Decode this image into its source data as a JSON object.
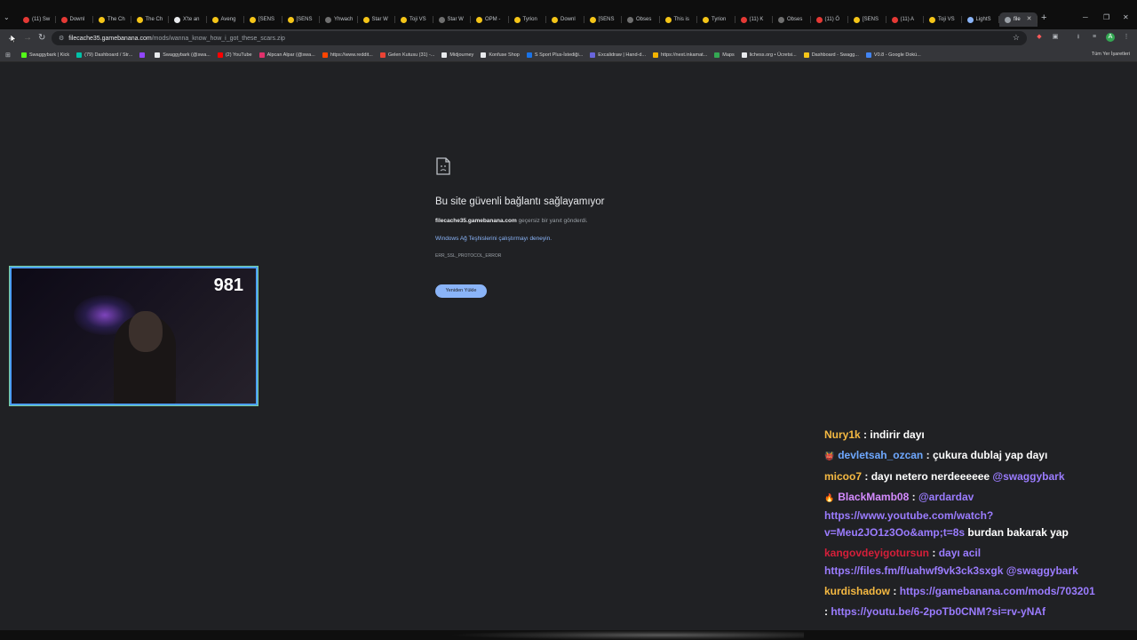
{
  "tabs": [
    {
      "label": "(11) Sw",
      "color": "#e53935"
    },
    {
      "label": "Downl",
      "color": "#e53935"
    },
    {
      "label": "The Ch",
      "color": "#f5c518"
    },
    {
      "label": "The Ch",
      "color": "#f5c518"
    },
    {
      "label": "X'te an",
      "color": "#e8eaed"
    },
    {
      "label": "Aveng",
      "color": "#f5c518"
    },
    {
      "label": "[SENS",
      "color": "#f5c518"
    },
    {
      "label": "[SENS",
      "color": "#f5c518"
    },
    {
      "label": "Yhwach",
      "color": "#6f6f6f"
    },
    {
      "label": "Star W",
      "color": "#f5c518"
    },
    {
      "label": "Toji VS",
      "color": "#f5c518"
    },
    {
      "label": "Star W",
      "color": "#6f6f6f"
    },
    {
      "label": "OPM -",
      "color": "#f5c518"
    },
    {
      "label": "Tyrion",
      "color": "#f5c518"
    },
    {
      "label": "Downl",
      "color": "#f5c518"
    },
    {
      "label": "[SENS",
      "color": "#f5c518"
    },
    {
      "label": "Obses",
      "color": "#6f6f6f"
    },
    {
      "label": "This is",
      "color": "#f5c518"
    },
    {
      "label": "Tyrion",
      "color": "#f5c518"
    },
    {
      "label": "(11) K",
      "color": "#e53935"
    },
    {
      "label": "Obses",
      "color": "#6f6f6f"
    },
    {
      "label": "(11) Ö",
      "color": "#e53935"
    },
    {
      "label": "[SENS",
      "color": "#f5c518"
    },
    {
      "label": "(11) A",
      "color": "#e53935"
    },
    {
      "label": "Toji VS",
      "color": "#f5c518"
    },
    {
      "label": "LightS",
      "color": "#8ab4f8"
    },
    {
      "label": "file",
      "color": "#9aa0a6",
      "active": true
    }
  ],
  "address": {
    "host": "filecache35.gamebanana.com",
    "path": "/mods/wanna_know_how_i_got_these_scars.zip"
  },
  "bookmarks": [
    {
      "label": "Swaggybark | Kick",
      "color": "#53fc18"
    },
    {
      "label": "(79) Dashboard / Str...",
      "color": "#00c2a8"
    },
    {
      "label": "",
      "color": "#9146ff"
    },
    {
      "label": "Swaggybark (@swa...",
      "color": "#e8eaed"
    },
    {
      "label": "(2) YouTube",
      "color": "#ff0000"
    },
    {
      "label": "Alpcan Alpar (@swa...",
      "color": "#e1306c"
    },
    {
      "label": "https://www.reddit...",
      "color": "#ff4500"
    },
    {
      "label": "Gelen Kutusu (31) -...",
      "color": "#ea4335"
    },
    {
      "label": "Midjourney",
      "color": "#e8eaed"
    },
    {
      "label": "Konfuse Shop",
      "color": "#e8eaed"
    },
    {
      "label": "S Sport Plus-İstediği...",
      "color": "#1a73e8"
    },
    {
      "label": "Excalidraw | Hand-d...",
      "color": "#6965db"
    },
    {
      "label": "https://next.inkamat...",
      "color": "#f4b400"
    },
    {
      "label": "Maps",
      "color": "#34a853"
    },
    {
      "label": "lichess.org • Ücretsi...",
      "color": "#e8eaed"
    },
    {
      "label": "Dashboard - Swagg...",
      "color": "#f5c518"
    },
    {
      "label": "V0.8 - Google Dokü...",
      "color": "#4285f4"
    }
  ],
  "bookmarks_all": "Tüm Yer İşaretleri",
  "error": {
    "title": "Bu site güvenli bağlantı sağlayamıyor",
    "host": "filecache35.gamebanana.com",
    "desc_suffix": " geçersiz bir yanıt gönderdi.",
    "link": "Windows Ağ Teşhislerini çalıştırmayı deneyin.",
    "code": "ERR_SSL_PROTOCOL_ERROR",
    "reload": "Yeniden Yükle"
  },
  "webcam": {
    "counter": "981"
  },
  "chat": [
    {
      "user": "Nury1k",
      "color": "#f5b942",
      "badge": "",
      "text": [
        {
          "t": "indirir dayı",
          "link": false
        }
      ]
    },
    {
      "user": "devletsah_ozcan",
      "color": "#6ea8ff",
      "badge": "👹",
      "text": [
        {
          "t": "çukura dublaj yap dayı",
          "link": false
        }
      ]
    },
    {
      "user": "micoo7",
      "color": "#f5b942",
      "badge": "",
      "text": [
        {
          "t": "dayı netero nerdeeeeee ",
          "link": false
        },
        {
          "t": "@swaggybark",
          "link": true
        }
      ]
    },
    {
      "user": "BlackMamb08",
      "color": "#d58bff",
      "badge": "🔥",
      "text": [
        {
          "t": "@ardardav https://www.youtube.com/watch?v=Meu2JO1z3Oo&amp;t=8s",
          "link": true
        },
        {
          "t": " burdan bakarak yap",
          "link": false
        }
      ]
    },
    {
      "user": "kangovdeyigotursun",
      "color": "#d61f3a",
      "badge": "",
      "text": [
        {
          "t": "dayı acil https://files.fm/f/uahwf9vk3ck3sxgk @swaggybark",
          "link": true
        }
      ]
    },
    {
      "user": "kurdishadow",
      "color": "#f5b942",
      "badge": "",
      "text": [
        {
          "t": "https://gamebanana.com/mods/703201",
          "link": true
        }
      ]
    },
    {
      "user": "",
      "color": "#ffffff",
      "badge": "",
      "text": [
        {
          "t": "https://youtu.be/6-2poTb0CNM?si=rv-yNAf",
          "link": true
        }
      ]
    }
  ]
}
